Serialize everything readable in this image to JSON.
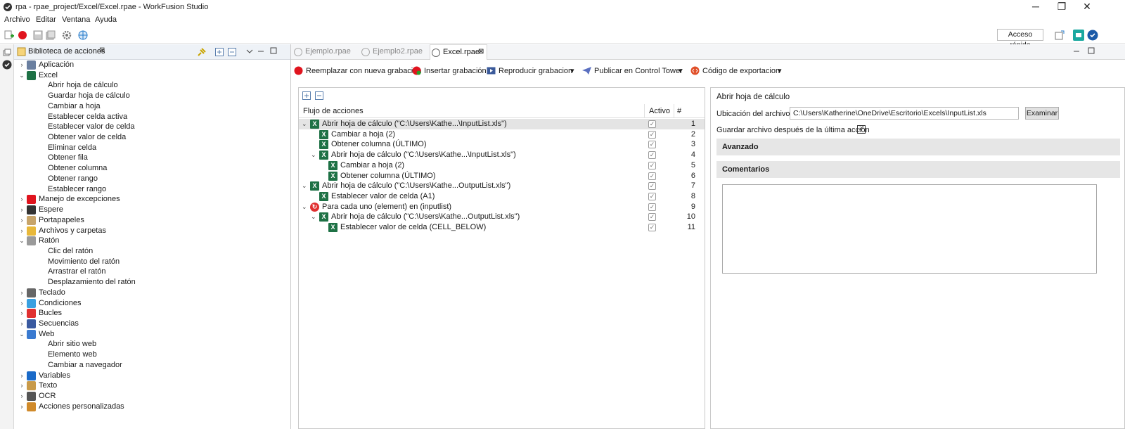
{
  "window": {
    "title": "rpa - rpae_project/Excel/Excel.rpae - WorkFusion Studio",
    "minimize": "─",
    "restore": "❐",
    "close": "✕"
  },
  "menu": [
    "Archivo",
    "Editar",
    "Ventana",
    "Ayuda"
  ],
  "toolbar": {
    "quick_access": "Acceso rápido"
  },
  "library": {
    "title": "Biblioteca de acciones",
    "items": [
      {
        "label": "Aplicación",
        "level": 0,
        "arrow": "›",
        "icon": "app"
      },
      {
        "label": "Excel",
        "level": 0,
        "arrow": "⌄",
        "icon": "excel"
      },
      {
        "label": "Abrir hoja de cálculo",
        "level": 1
      },
      {
        "label": "Guardar hoja de cálculo",
        "level": 1
      },
      {
        "label": "Cambiar a hoja",
        "level": 1
      },
      {
        "label": "Establecer celda activa",
        "level": 1
      },
      {
        "label": "Establecer valor de celda",
        "level": 1
      },
      {
        "label": "Obtener valor de celda",
        "level": 1
      },
      {
        "label": "Eliminar celda",
        "level": 1
      },
      {
        "label": "Obtener fila",
        "level": 1
      },
      {
        "label": "Obtener columna",
        "level": 1
      },
      {
        "label": "Obtener rango",
        "level": 1
      },
      {
        "label": "Establecer rango",
        "level": 1
      },
      {
        "label": "Manejo de excepciones",
        "level": 0,
        "arrow": "›",
        "icon": "flag"
      },
      {
        "label": "Espere",
        "level": 0,
        "arrow": "›",
        "icon": "clock"
      },
      {
        "label": "Portapapeles",
        "level": 0,
        "arrow": "›",
        "icon": "clip"
      },
      {
        "label": "Archivos y carpetas",
        "level": 0,
        "arrow": "›",
        "icon": "folder"
      },
      {
        "label": "Ratón",
        "level": 0,
        "arrow": "⌄",
        "icon": "mouse"
      },
      {
        "label": "Clic del ratón",
        "level": 1
      },
      {
        "label": "Movimiento del ratón",
        "level": 1
      },
      {
        "label": "Arrastrar el ratón",
        "level": 1
      },
      {
        "label": "Desplazamiento del ratón",
        "level": 1
      },
      {
        "label": "Teclado",
        "level": 0,
        "arrow": "›",
        "icon": "keyboard"
      },
      {
        "label": "Condiciones",
        "level": 0,
        "arrow": "›",
        "icon": "cond"
      },
      {
        "label": "Bucles",
        "level": 0,
        "arrow": "›",
        "icon": "loop"
      },
      {
        "label": "Secuencias",
        "level": 0,
        "arrow": "›",
        "icon": "seq"
      },
      {
        "label": "Web",
        "level": 0,
        "arrow": "⌄",
        "icon": "web"
      },
      {
        "label": "Abrir sitio web",
        "level": 1
      },
      {
        "label": "Elemento web",
        "level": 1
      },
      {
        "label": "Cambiar a navegador",
        "level": 1
      },
      {
        "label": "Variables",
        "level": 0,
        "arrow": "›",
        "icon": "var"
      },
      {
        "label": "Texto",
        "level": 0,
        "arrow": "›",
        "icon": "text"
      },
      {
        "label": "OCR",
        "level": 0,
        "arrow": "›",
        "icon": "ocr"
      },
      {
        "label": "Acciones personalizadas",
        "level": 0,
        "arrow": "›",
        "icon": "custom"
      }
    ]
  },
  "tabs": [
    {
      "label": "Ejemplo.rpae",
      "active": false
    },
    {
      "label": "Ejemplo2.rpae",
      "active": false
    },
    {
      "label": "Excel.rpae",
      "active": true,
      "close": "⊠"
    }
  ],
  "record_bar": {
    "replace": "Reemplazar con nueva grabación",
    "insert": "Insertar grabación",
    "play": "Reproducir grabacion",
    "publish": "Publicar en Control Tower",
    "export": "Código de exportacion",
    "dropdown": "▾"
  },
  "flow": {
    "col_flow": "Flujo de acciones",
    "col_active": "Activo",
    "col_num": "#",
    "rows": [
      {
        "label": "Abrir hoja de cálculo (\"C:\\Users\\Kathe...\\InputList.xls\")",
        "indent": 0,
        "expand": "⌄",
        "icon": "excel",
        "num": "1",
        "selected": true
      },
      {
        "label": "Cambiar a hoja (2)",
        "indent": 1,
        "icon": "excel",
        "num": "2"
      },
      {
        "label": "Obtener columna (ÚLTIMO)",
        "indent": 1,
        "icon": "excel",
        "num": "3"
      },
      {
        "label": "Abrir hoja de cálculo (\"C:\\Users\\Kathe...\\InputList.xls\")",
        "indent": 1,
        "expand": "⌄",
        "icon": "excel",
        "num": "4"
      },
      {
        "label": "Cambiar a hoja (2)",
        "indent": 2,
        "icon": "excel",
        "num": "5"
      },
      {
        "label": "Obtener columna (ÚLTIMO)",
        "indent": 2,
        "icon": "excel",
        "num": "6"
      },
      {
        "label": "Abrir hoja de cálculo (\"C:\\Users\\Kathe...OutputList.xls\")",
        "indent": 0,
        "expand": "⌄",
        "icon": "excel",
        "num": "7"
      },
      {
        "label": "Establecer valor de celda (A1)",
        "indent": 1,
        "icon": "excel",
        "num": "8"
      },
      {
        "label": "Para cada uno (element) en (inputlist)",
        "indent": 0,
        "expand": "⌄",
        "icon": "loop",
        "num": "9"
      },
      {
        "label": "Abrir hoja de cálculo (\"C:\\Users\\Kathe...OutputList.xls\")",
        "indent": 1,
        "expand": "⌄",
        "icon": "excel",
        "num": "10"
      },
      {
        "label": "Establecer valor de celda (CELL_BELOW)",
        "indent": 2,
        "icon": "excel",
        "num": "11"
      }
    ]
  },
  "props": {
    "title": "Abrir hoja de cálculo",
    "file_label": "Ubicación del archivo:",
    "file_value": "C:\\Users\\Katherine\\OneDrive\\Escritorio\\Excels\\InputList.xls",
    "browse": "Examinar",
    "save_label": "Guardar archivo después de la última acción",
    "save_checked": "✓",
    "advanced": "Avanzado",
    "comments": "Comentarios"
  },
  "colors": {
    "record_red": "#e0141e",
    "excel_green": "#1e7145",
    "accent_blue": "#1f77c9"
  }
}
